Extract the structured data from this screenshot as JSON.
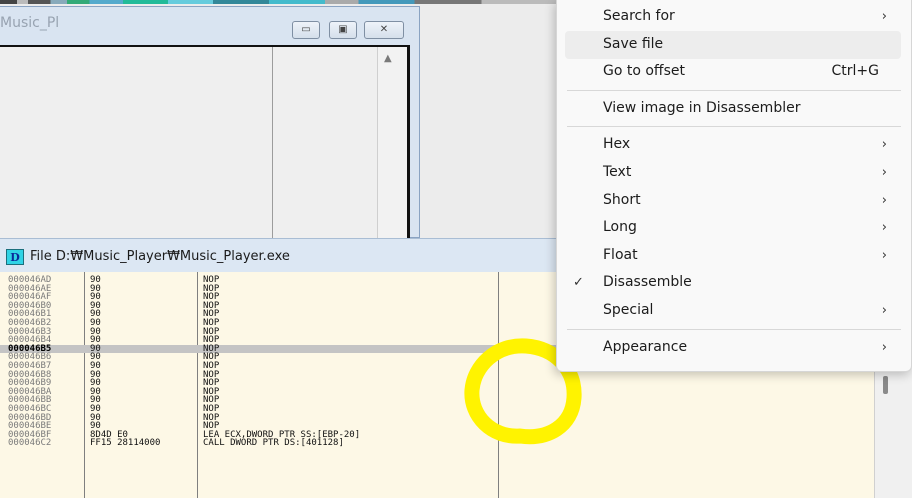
{
  "music_window": {
    "title": "Music_Pl",
    "buttons": {
      "minimize": "▭",
      "maximize": "▣",
      "close": "✕"
    }
  },
  "file_window": {
    "icon_glyph": "D",
    "title": "File D:₩Music_Player₩Music_Player.exe",
    "rows": [
      {
        "addr": "000046AD",
        "hex": "90",
        "asm": "NOP"
      },
      {
        "addr": "000046AE",
        "hex": "90",
        "asm": "NOP"
      },
      {
        "addr": "000046AF",
        "hex": "90",
        "asm": "NOP"
      },
      {
        "addr": "000046B0",
        "hex": "90",
        "asm": "NOP"
      },
      {
        "addr": "000046B1",
        "hex": "90",
        "asm": "NOP"
      },
      {
        "addr": "000046B2",
        "hex": "90",
        "asm": "NOP"
      },
      {
        "addr": "000046B3",
        "hex": "90",
        "asm": "NOP"
      },
      {
        "addr": "000046B4",
        "hex": "90",
        "asm": "NOP"
      },
      {
        "addr": "000046B5",
        "hex": "90",
        "asm": "NOP",
        "selected": true
      },
      {
        "addr": "000046B6",
        "hex": "90",
        "asm": "NOP"
      },
      {
        "addr": "000046B7",
        "hex": "90",
        "asm": "NOP"
      },
      {
        "addr": "000046B8",
        "hex": "90",
        "asm": "NOP"
      },
      {
        "addr": "000046B9",
        "hex": "90",
        "asm": "NOP"
      },
      {
        "addr": "000046BA",
        "hex": "90",
        "asm": "NOP"
      },
      {
        "addr": "000046BB",
        "hex": "90",
        "asm": "NOP"
      },
      {
        "addr": "000046BC",
        "hex": "90",
        "asm": "NOP"
      },
      {
        "addr": "000046BD",
        "hex": "90",
        "asm": "NOP"
      },
      {
        "addr": "000046BE",
        "hex": "90",
        "asm": "NOP"
      },
      {
        "addr": "000046BF",
        "hex": "8D4D E0",
        "asm": "LEA ECX,DWORD PTR SS:[EBP-20]"
      },
      {
        "addr": "000046C2",
        "hex": "FF15 28114000",
        "asm": "CALL DWORD PTR DS:[401128]"
      }
    ]
  },
  "context_menu": {
    "items": [
      {
        "label": "Search for",
        "arrow": "›"
      },
      {
        "label": "Save file",
        "highlighted": true
      },
      {
        "label": "Go to offset",
        "shortcut": "Ctrl+G"
      },
      {
        "separator": true
      },
      {
        "label": "View image in Disassembler"
      },
      {
        "separator": true
      },
      {
        "label": "Hex",
        "arrow": "›"
      },
      {
        "label": "Text",
        "arrow": "›"
      },
      {
        "label": "Short",
        "arrow": "›"
      },
      {
        "label": "Long",
        "arrow": "›"
      },
      {
        "label": "Float",
        "arrow": "›"
      },
      {
        "label": "Disassemble",
        "check": "✓"
      },
      {
        "label": "Special",
        "arrow": "›"
      },
      {
        "separator": true
      },
      {
        "label": "Appearance",
        "arrow": "›"
      }
    ]
  },
  "colors": {
    "annotation_yellow": "#fff300",
    "dump_background": "#fdf8e6",
    "selected_row": "#c4c4c4",
    "file_icon": "#30d3e5"
  }
}
